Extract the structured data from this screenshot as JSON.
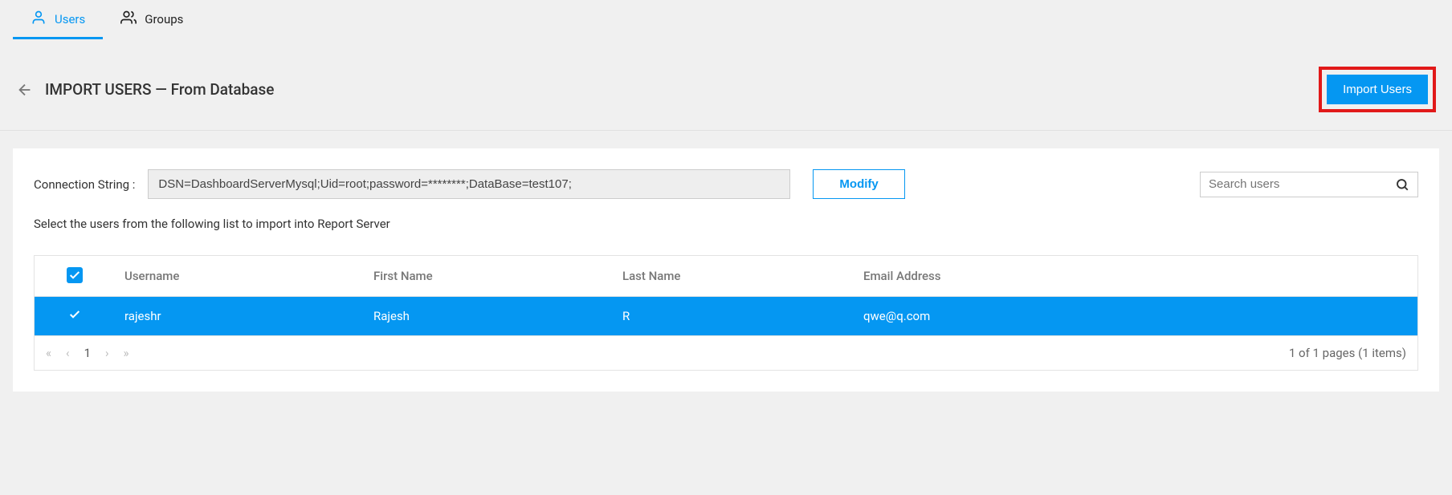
{
  "tabs": {
    "users": "Users",
    "groups": "Groups"
  },
  "header": {
    "title": "IMPORT USERS — From Database",
    "import_btn": "Import Users"
  },
  "panel": {
    "conn_label": "Connection String :",
    "conn_value": "DSN=DashboardServerMysql;Uid=root;password=********;DataBase=test107;",
    "modify_btn": "Modify",
    "search_placeholder": "Search users",
    "instruction": "Select the users from the following list to import into Report Server"
  },
  "table": {
    "headers": {
      "username": "Username",
      "first_name": "First Name",
      "last_name": "Last Name",
      "email": "Email Address"
    },
    "rows": [
      {
        "username": "rajeshr",
        "first_name": "Rajesh",
        "last_name": "R",
        "email": "qwe@q.com"
      }
    ]
  },
  "pager": {
    "current": "1",
    "info": "1 of 1 pages (1 items)"
  }
}
